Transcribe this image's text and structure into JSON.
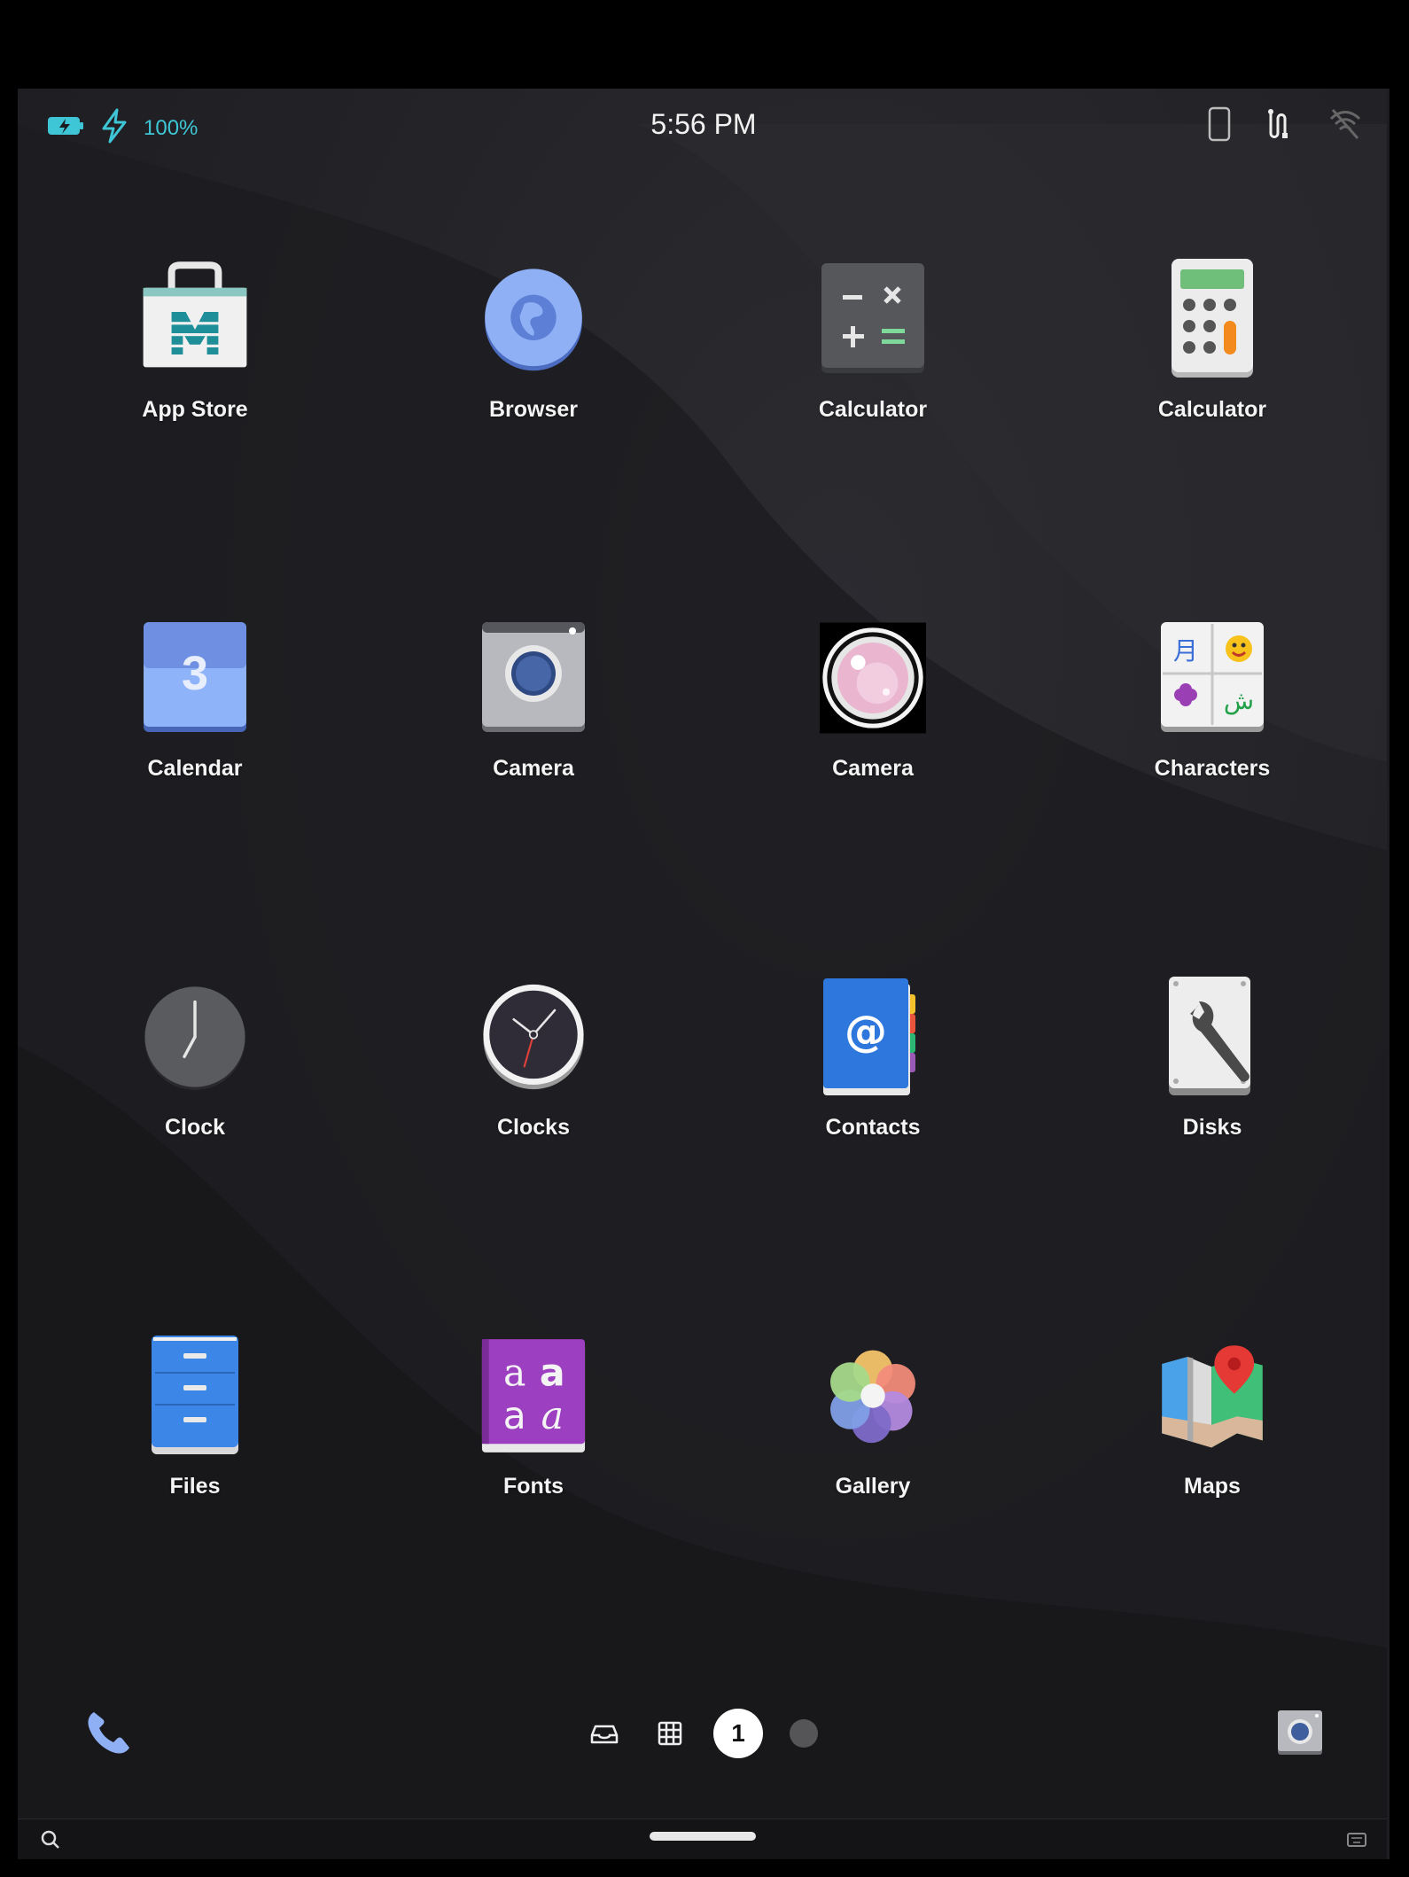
{
  "status_bar": {
    "battery_icon": "battery-charging-icon",
    "charging_icon": "lightning-icon",
    "battery_percent": "100%",
    "time": "5:56 PM",
    "right_icons": [
      "phone-device-icon",
      "usb-debug-icon",
      "wifi-off-icon"
    ]
  },
  "apps": [
    {
      "label": "App Store",
      "icon": "app-store-icon"
    },
    {
      "label": "Browser",
      "icon": "browser-globe-icon"
    },
    {
      "label": "Calculator",
      "icon": "calculator-dark-icon"
    },
    {
      "label": "Calculator",
      "icon": "calculator-light-icon"
    },
    {
      "label": "Calendar",
      "icon": "calendar-icon",
      "day": "3"
    },
    {
      "label": "Camera",
      "icon": "camera-icon"
    },
    {
      "label": "Camera",
      "icon": "camera-lens-icon"
    },
    {
      "label": "Characters",
      "icon": "characters-icon"
    },
    {
      "label": "Clock",
      "icon": "clock-icon"
    },
    {
      "label": "Clocks",
      "icon": "clocks-icon"
    },
    {
      "label": "Contacts",
      "icon": "contacts-icon"
    },
    {
      "label": "Disks",
      "icon": "disks-icon"
    },
    {
      "label": "Files",
      "icon": "files-icon"
    },
    {
      "label": "Fonts",
      "icon": "fonts-icon"
    },
    {
      "label": "Gallery",
      "icon": "gallery-icon"
    },
    {
      "label": "Maps",
      "icon": "maps-icon"
    }
  ],
  "dock": {
    "left_icon": "phone-icon",
    "center_icons": [
      "inbox-icon",
      "grid-icon"
    ],
    "current_page": "1",
    "right_icon": "camera-icon"
  },
  "bottom_bar": {
    "left_icon": "search-icon",
    "right_icon": "keyboard-icon"
  },
  "colors": {
    "accent": "#3ec6d6",
    "background": "#222226"
  }
}
